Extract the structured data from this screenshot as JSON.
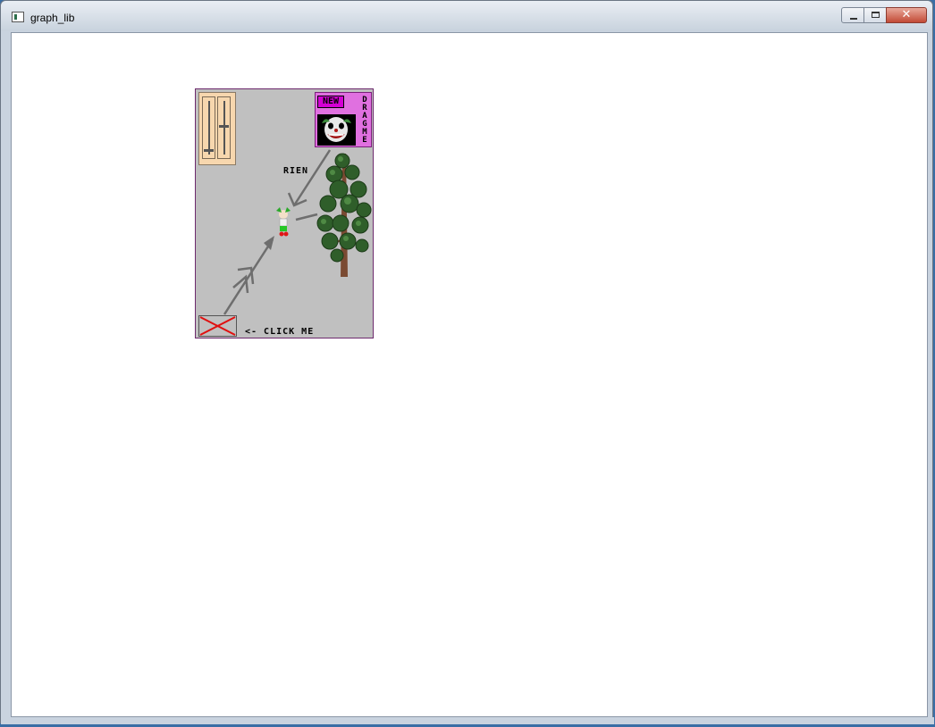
{
  "window": {
    "title": "graph_lib",
    "controls": {
      "minimize": "",
      "maximize": "",
      "close": "✕"
    }
  },
  "panel": {
    "new_badge": "NEW",
    "drag_label": "DRAG ME",
    "rien_label": "RIEN",
    "click_label": "<- CLICK ME",
    "icons": [
      "slider-icon",
      "clown-face-icon",
      "clown-sprite-icon",
      "tree-icon",
      "cross-icon",
      "arrow-icon"
    ],
    "colors": {
      "background": "#c0c0c0",
      "new_box": "#e070e0",
      "new_badge": "#d400d4",
      "slider_box": "#f7d7ae",
      "cross": "#e01010",
      "arrow": "#6e6e6e"
    },
    "sliders": [
      {
        "name": "left",
        "level": 0.9
      },
      {
        "name": "right",
        "level": 0.45
      }
    ]
  }
}
